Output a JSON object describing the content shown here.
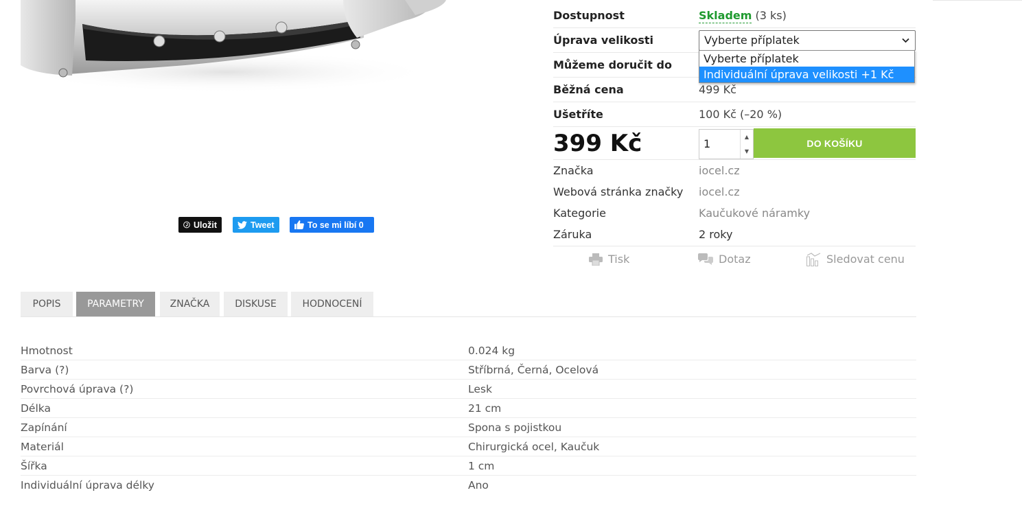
{
  "share": {
    "pinterest_label": "Uložit",
    "tweet_label": "Tweet",
    "facebook_label": "To se mi líbí 0"
  },
  "product_info": {
    "availability_label": "Dostupnost",
    "availability_value": "Skladem",
    "availability_count": "(3 ks)",
    "size_label": "Úprava velikosti",
    "size_select_value": "Vyberte příplatek",
    "size_options": [
      "Vyberte příplatek",
      "Individuální úprava velikosti +1 Kč"
    ],
    "delivery_label": "Můžeme doručit do",
    "regular_price_label": "Běžná cena",
    "regular_price_value": "499 Kč",
    "save_label": "Ušetříte",
    "save_value": "100 Kč (–20 %)",
    "price": "399 Kč",
    "quantity": "1",
    "cart_button": "DO KOŠÍKU"
  },
  "details": [
    {
      "label": "Značka",
      "value": "iocel.cz"
    },
    {
      "label": "Webová stránka značky",
      "value": "iocel.cz"
    },
    {
      "label": "Kategorie",
      "value": "Kaučukové náramky"
    },
    {
      "label": "Záruka",
      "value": "2 roky"
    }
  ],
  "actions": {
    "print": "Tisk",
    "ask": "Dotaz",
    "watch": "Sledovat cenu"
  },
  "tabs": [
    {
      "label": "POPIS"
    },
    {
      "label": "PARAMETRY"
    },
    {
      "label": "ZNAČKA"
    },
    {
      "label": "DISKUSE"
    },
    {
      "label": "HODNOCENÍ"
    }
  ],
  "parameters": [
    {
      "name": "Hmotnost",
      "value": "0.024 kg"
    },
    {
      "name": "Barva (?)",
      "value": "Stříbrná, Černá, Ocelová"
    },
    {
      "name": "Povrchová úprava (?)",
      "value": "Lesk"
    },
    {
      "name": "Délka",
      "value": "21 cm"
    },
    {
      "name": "Zapínání",
      "value": "Spona s pojistkou"
    },
    {
      "name": "Materiál",
      "value": "Chirurgická ocel, Kaučuk"
    },
    {
      "name": "Šířka",
      "value": "1 cm"
    },
    {
      "name": "Individuální úprava délky",
      "value": "Ano"
    }
  ],
  "colors": {
    "accent_green": "#8dc63f",
    "stock_green": "#1f9a2f",
    "active_tab": "#999999",
    "dropdown_highlight": "#1e90ff"
  }
}
